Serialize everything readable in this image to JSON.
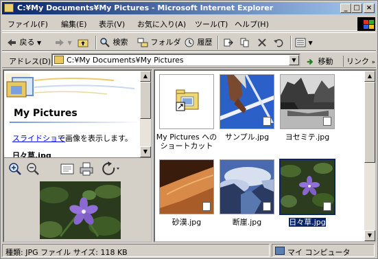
{
  "window": {
    "title": "C:¥My Documents¥My Pictures - Microsoft Internet Explorer",
    "controls": {
      "minimize": "_",
      "maximize": "□",
      "close": "×"
    }
  },
  "menu": {
    "items": [
      "ファイル(F)",
      "編集(E)",
      "表示(V)",
      "お気に入り(A)",
      "ツール(T)",
      "ヘルプ(H)"
    ]
  },
  "toolbar": {
    "back": "戻る",
    "search": "検索",
    "folders": "フォルダ",
    "history": "履歴"
  },
  "address": {
    "label": "アドレス(D)",
    "value": "C:¥My Documents¥My Pictures",
    "go": "移動",
    "links": "リンク"
  },
  "left_pane": {
    "folder_title": "My Pictures",
    "slideshow_link": "スライドショー",
    "slideshow_text": "で画像を表示します。",
    "selected_file": "日々草.jpg"
  },
  "files": [
    {
      "name": "My Pictures へのショートカット",
      "line1": "My Pictures への",
      "line2": "ショートカット",
      "kind": "shortcut"
    },
    {
      "name": "サンプル.jpg",
      "kind": "image"
    },
    {
      "name": "ヨセミテ.jpg",
      "kind": "image"
    },
    {
      "name": "砂漠.jpg",
      "kind": "image"
    },
    {
      "name": "断崖.jpg",
      "kind": "image"
    },
    {
      "name": "日々草.jpg",
      "kind": "image",
      "selected": true
    }
  ],
  "status": {
    "left": "種類: JPG ファイル サイズ: 118 KB",
    "right": "マイ コンピュータ"
  },
  "colors": {
    "titlebar": "#0a246a",
    "selection": "#0a246a",
    "link": "#0000ff"
  }
}
